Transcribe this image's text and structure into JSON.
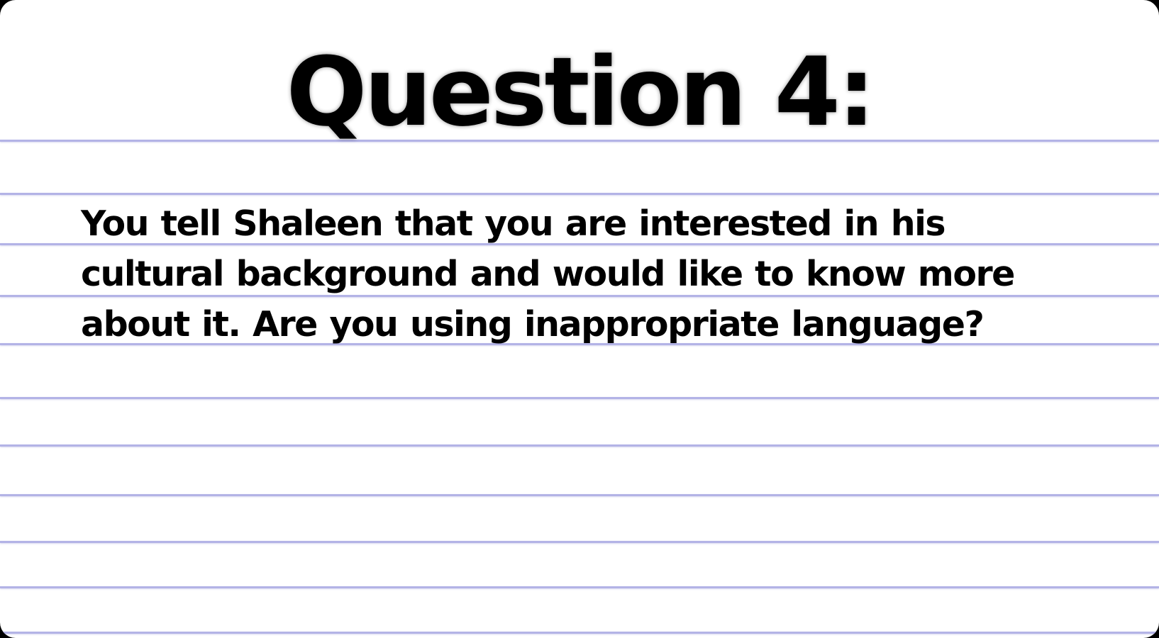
{
  "slide": {
    "title": "Question 4:",
    "question": "You tell Shaleen that you are interested in his cultural background and would like to know more about it. Are you using inappropriate language?"
  },
  "colors": {
    "background": "#ffffff",
    "ruled_lines": "#b3b3e6",
    "text": "#000000",
    "frame": "#000000"
  }
}
